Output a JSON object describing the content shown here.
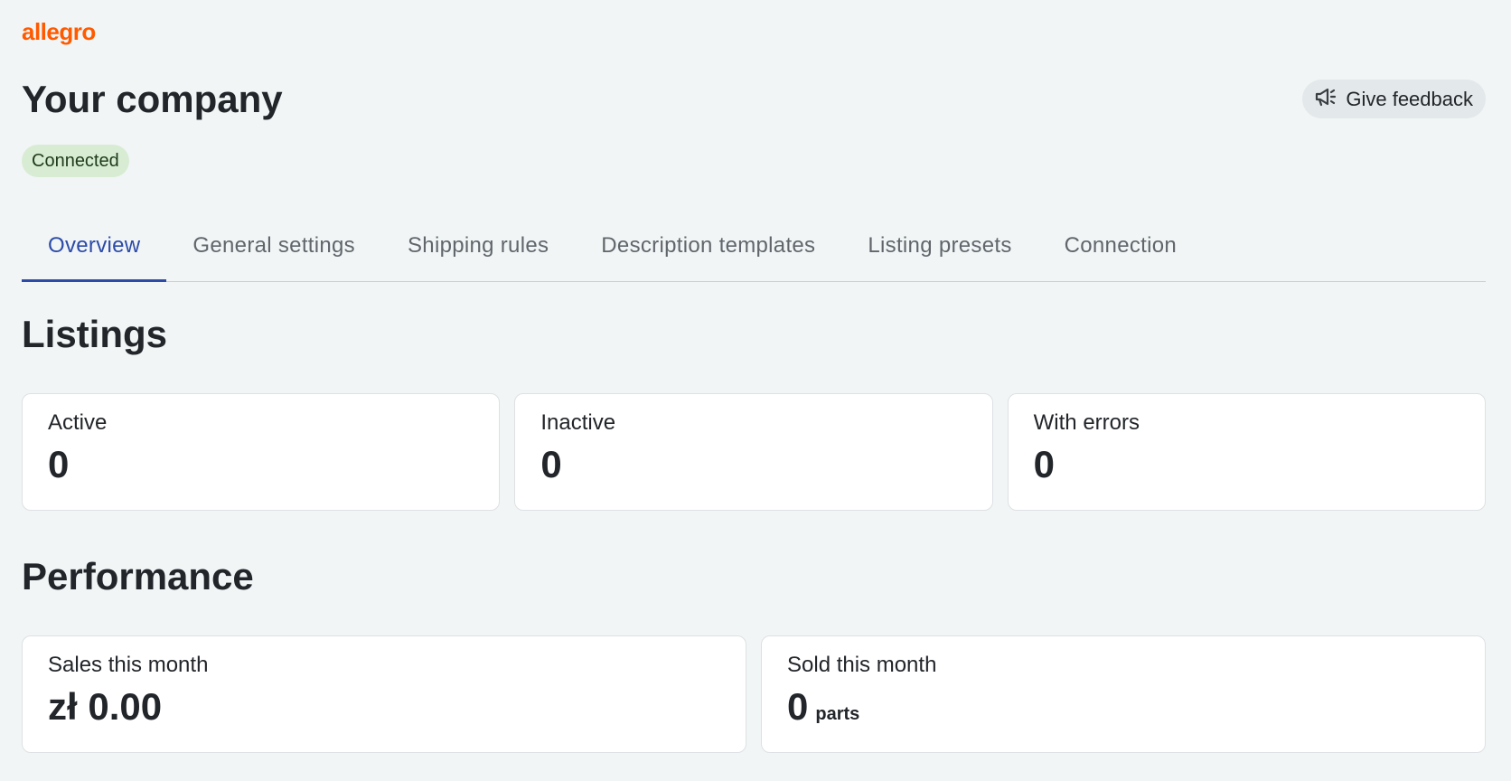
{
  "brand": {
    "logo_text": "allegro",
    "logo_color": "#ff5a00"
  },
  "header": {
    "title": "Your company",
    "status": "Connected",
    "feedback_label": "Give feedback",
    "feedback_icon": "megaphone-icon"
  },
  "tabs": [
    {
      "label": "Overview",
      "active": true
    },
    {
      "label": "General settings",
      "active": false
    },
    {
      "label": "Shipping rules",
      "active": false
    },
    {
      "label": "Description templates",
      "active": false
    },
    {
      "label": "Listing presets",
      "active": false
    },
    {
      "label": "Connection",
      "active": false
    }
  ],
  "listings": {
    "title": "Listings",
    "cards": [
      {
        "label": "Active",
        "value": "0"
      },
      {
        "label": "Inactive",
        "value": "0"
      },
      {
        "label": "With errors",
        "value": "0"
      }
    ]
  },
  "performance": {
    "title": "Performance",
    "cards": [
      {
        "label": "Sales this month",
        "value": "zł 0.00",
        "unit": ""
      },
      {
        "label": "Sold this month",
        "value": "0",
        "unit": "parts"
      }
    ]
  },
  "colors": {
    "accent": "#2c4ba8",
    "status_bg": "#d8ecd3",
    "background": "#f1f5f6"
  }
}
